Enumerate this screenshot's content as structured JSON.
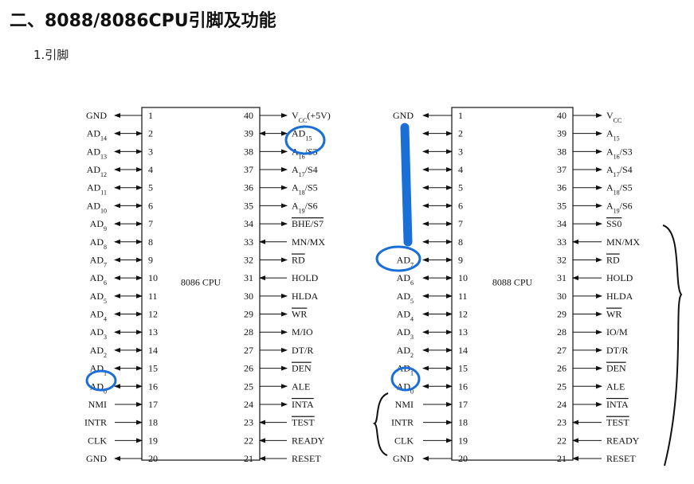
{
  "title": "二、8088/8086CPU引脚及功能",
  "subtitle": "1.引脚",
  "chip8086": {
    "name": "8086 CPU",
    "left": [
      {
        "n": "1",
        "pre": "GND",
        "sub": "",
        "post": "",
        "dir": "out"
      },
      {
        "n": "2",
        "pre": "AD",
        "sub": "14",
        "post": "",
        "dir": "bi"
      },
      {
        "n": "3",
        "pre": "AD",
        "sub": "13",
        "post": "",
        "dir": "bi"
      },
      {
        "n": "4",
        "pre": "AD",
        "sub": "12",
        "post": "",
        "dir": "bi"
      },
      {
        "n": "5",
        "pre": "AD",
        "sub": "11",
        "post": "",
        "dir": "bi"
      },
      {
        "n": "6",
        "pre": "AD",
        "sub": "10",
        "post": "",
        "dir": "bi"
      },
      {
        "n": "7",
        "pre": "AD",
        "sub": "9",
        "post": "",
        "dir": "bi"
      },
      {
        "n": "8",
        "pre": "AD",
        "sub": "8",
        "post": "",
        "dir": "bi"
      },
      {
        "n": "9",
        "pre": "AD",
        "sub": "7",
        "post": "",
        "dir": "bi"
      },
      {
        "n": "10",
        "pre": "AD",
        "sub": "6",
        "post": "",
        "dir": "bi"
      },
      {
        "n": "11",
        "pre": "AD",
        "sub": "5",
        "post": "",
        "dir": "bi"
      },
      {
        "n": "12",
        "pre": "AD",
        "sub": "4",
        "post": "",
        "dir": "bi"
      },
      {
        "n": "13",
        "pre": "AD",
        "sub": "3",
        "post": "",
        "dir": "bi"
      },
      {
        "n": "14",
        "pre": "AD",
        "sub": "2",
        "post": "",
        "dir": "bi"
      },
      {
        "n": "15",
        "pre": "AD",
        "sub": "1",
        "post": "",
        "dir": "bi"
      },
      {
        "n": "16",
        "pre": "AD",
        "sub": "0",
        "post": "",
        "dir": "bi"
      },
      {
        "n": "17",
        "pre": "NMI",
        "sub": "",
        "post": "",
        "dir": "in"
      },
      {
        "n": "18",
        "pre": "INTR",
        "sub": "",
        "post": "",
        "dir": "in"
      },
      {
        "n": "19",
        "pre": "CLK",
        "sub": "",
        "post": "",
        "dir": "in"
      },
      {
        "n": "20",
        "pre": "GND",
        "sub": "",
        "post": "",
        "dir": "out"
      }
    ],
    "right": [
      {
        "n": "40",
        "pre": "V",
        "sub": "CC",
        "post": "(+5V)",
        "over": false,
        "dir": "out"
      },
      {
        "n": "39",
        "pre": "AD",
        "sub": "15",
        "post": "",
        "over": false,
        "dir": "bi"
      },
      {
        "n": "38",
        "pre": "A",
        "sub": "16",
        "post": "/S3",
        "over": false,
        "dir": "out"
      },
      {
        "n": "37",
        "pre": "A",
        "sub": "17",
        "post": "/S4",
        "over": false,
        "dir": "out"
      },
      {
        "n": "36",
        "pre": "A",
        "sub": "18",
        "post": "/S5",
        "over": false,
        "dir": "out"
      },
      {
        "n": "35",
        "pre": "A",
        "sub": "19",
        "post": "/S6",
        "over": false,
        "dir": "out"
      },
      {
        "n": "34",
        "pre": "BHE/S7",
        "sub": "",
        "post": "",
        "over": true,
        "dir": "out"
      },
      {
        "n": "33",
        "pre": "MN/MX",
        "sub": "",
        "post": "",
        "over": false,
        "dir": "in"
      },
      {
        "n": "32",
        "pre": "RD",
        "sub": "",
        "post": "",
        "over": true,
        "dir": "out"
      },
      {
        "n": "31",
        "pre": "HOLD",
        "sub": "",
        "post": "",
        "over": false,
        "dir": "in"
      },
      {
        "n": "30",
        "pre": "HLDA",
        "sub": "",
        "post": "",
        "over": false,
        "dir": "out"
      },
      {
        "n": "29",
        "pre": "WR",
        "sub": "",
        "post": "",
        "over": true,
        "dir": "out"
      },
      {
        "n": "28",
        "pre": "M/IO",
        "sub": "",
        "post": "",
        "over": false,
        "dir": "out"
      },
      {
        "n": "27",
        "pre": "DT/R",
        "sub": "",
        "post": "",
        "over": false,
        "dir": "out"
      },
      {
        "n": "26",
        "pre": "DEN",
        "sub": "",
        "post": "",
        "over": true,
        "dir": "out"
      },
      {
        "n": "25",
        "pre": "ALE",
        "sub": "",
        "post": "",
        "over": false,
        "dir": "out"
      },
      {
        "n": "24",
        "pre": "INTA",
        "sub": "",
        "post": "",
        "over": true,
        "dir": "out"
      },
      {
        "n": "23",
        "pre": "TEST",
        "sub": "",
        "post": "",
        "over": true,
        "dir": "in"
      },
      {
        "n": "22",
        "pre": "READY",
        "sub": "",
        "post": "",
        "over": false,
        "dir": "in"
      },
      {
        "n": "21",
        "pre": "RESET",
        "sub": "",
        "post": "",
        "over": false,
        "dir": "in"
      }
    ]
  },
  "chip8088": {
    "name": "8088 CPU",
    "left": [
      {
        "n": "1",
        "pre": "GND",
        "sub": "",
        "post": "",
        "dir": "out"
      },
      {
        "n": "2",
        "pre": "",
        "sub": "",
        "post": "",
        "dir": "bi"
      },
      {
        "n": "3",
        "pre": "",
        "sub": "",
        "post": "",
        "dir": "bi"
      },
      {
        "n": "4",
        "pre": "",
        "sub": "",
        "post": "",
        "dir": "bi"
      },
      {
        "n": "5",
        "pre": "",
        "sub": "",
        "post": "",
        "dir": "bi"
      },
      {
        "n": "6",
        "pre": "",
        "sub": "",
        "post": "",
        "dir": "bi"
      },
      {
        "n": "7",
        "pre": "",
        "sub": "",
        "post": "",
        "dir": "bi"
      },
      {
        "n": "8",
        "pre": "",
        "sub": "",
        "post": "",
        "dir": "bi"
      },
      {
        "n": "9",
        "pre": "AD",
        "sub": "7",
        "post": "",
        "dir": "bi"
      },
      {
        "n": "10",
        "pre": "AD",
        "sub": "6",
        "post": "",
        "dir": "bi"
      },
      {
        "n": "11",
        "pre": "AD",
        "sub": "5",
        "post": "",
        "dir": "bi"
      },
      {
        "n": "12",
        "pre": "AD",
        "sub": "4",
        "post": "",
        "dir": "bi"
      },
      {
        "n": "13",
        "pre": "AD",
        "sub": "3",
        "post": "",
        "dir": "bi"
      },
      {
        "n": "14",
        "pre": "AD",
        "sub": "2",
        "post": "",
        "dir": "bi"
      },
      {
        "n": "15",
        "pre": "AD",
        "sub": "1",
        "post": "",
        "dir": "bi"
      },
      {
        "n": "16",
        "pre": "AD",
        "sub": "0",
        "post": "",
        "dir": "bi"
      },
      {
        "n": "17",
        "pre": "NMI",
        "sub": "",
        "post": "",
        "dir": "in"
      },
      {
        "n": "18",
        "pre": "INTR",
        "sub": "",
        "post": "",
        "dir": "in"
      },
      {
        "n": "19",
        "pre": "CLK",
        "sub": "",
        "post": "",
        "dir": "in"
      },
      {
        "n": "20",
        "pre": "GND",
        "sub": "",
        "post": "",
        "dir": "out"
      }
    ],
    "right": [
      {
        "n": "40",
        "pre": "V",
        "sub": "CC",
        "post": "",
        "over": false,
        "dir": "out"
      },
      {
        "n": "39",
        "pre": "A",
        "sub": "15",
        "post": "",
        "over": false,
        "dir": "out"
      },
      {
        "n": "38",
        "pre": "A",
        "sub": "16",
        "post": "/S3",
        "over": false,
        "dir": "out"
      },
      {
        "n": "37",
        "pre": "A",
        "sub": "17",
        "post": "/S4",
        "over": false,
        "dir": "out"
      },
      {
        "n": "36",
        "pre": "A",
        "sub": "18",
        "post": "/S5",
        "over": false,
        "dir": "out"
      },
      {
        "n": "35",
        "pre": "A",
        "sub": "19",
        "post": "/S6",
        "over": false,
        "dir": "out"
      },
      {
        "n": "34",
        "pre": "SS0",
        "sub": "",
        "post": "",
        "over": true,
        "dir": "out"
      },
      {
        "n": "33",
        "pre": "MN/MX",
        "sub": "",
        "post": "",
        "over": false,
        "dir": "in"
      },
      {
        "n": "32",
        "pre": "RD",
        "sub": "",
        "post": "",
        "over": true,
        "dir": "out"
      },
      {
        "n": "31",
        "pre": "HOLD",
        "sub": "",
        "post": "",
        "over": false,
        "dir": "in"
      },
      {
        "n": "30",
        "pre": "HLDA",
        "sub": "",
        "post": "",
        "over": false,
        "dir": "out"
      },
      {
        "n": "29",
        "pre": "WR",
        "sub": "",
        "post": "",
        "over": true,
        "dir": "out"
      },
      {
        "n": "28",
        "pre": "IO/M",
        "sub": "",
        "post": "",
        "over": false,
        "dir": "out"
      },
      {
        "n": "27",
        "pre": "DT/R",
        "sub": "",
        "post": "",
        "over": false,
        "dir": "out"
      },
      {
        "n": "26",
        "pre": "DEN",
        "sub": "",
        "post": "",
        "over": true,
        "dir": "out"
      },
      {
        "n": "25",
        "pre": "ALE",
        "sub": "",
        "post": "",
        "over": false,
        "dir": "out"
      },
      {
        "n": "24",
        "pre": "INTA",
        "sub": "",
        "post": "",
        "over": true,
        "dir": "out"
      },
      {
        "n": "23",
        "pre": "TEST",
        "sub": "",
        "post": "",
        "over": true,
        "dir": "in"
      },
      {
        "n": "22",
        "pre": "READY",
        "sub": "",
        "post": "",
        "over": false,
        "dir": "in"
      },
      {
        "n": "21",
        "pre": "RESET",
        "sub": "",
        "post": "",
        "over": false,
        "dir": "in"
      }
    ]
  },
  "colors": {
    "ink": "#111111",
    "annotation": "#1a6fd6"
  }
}
